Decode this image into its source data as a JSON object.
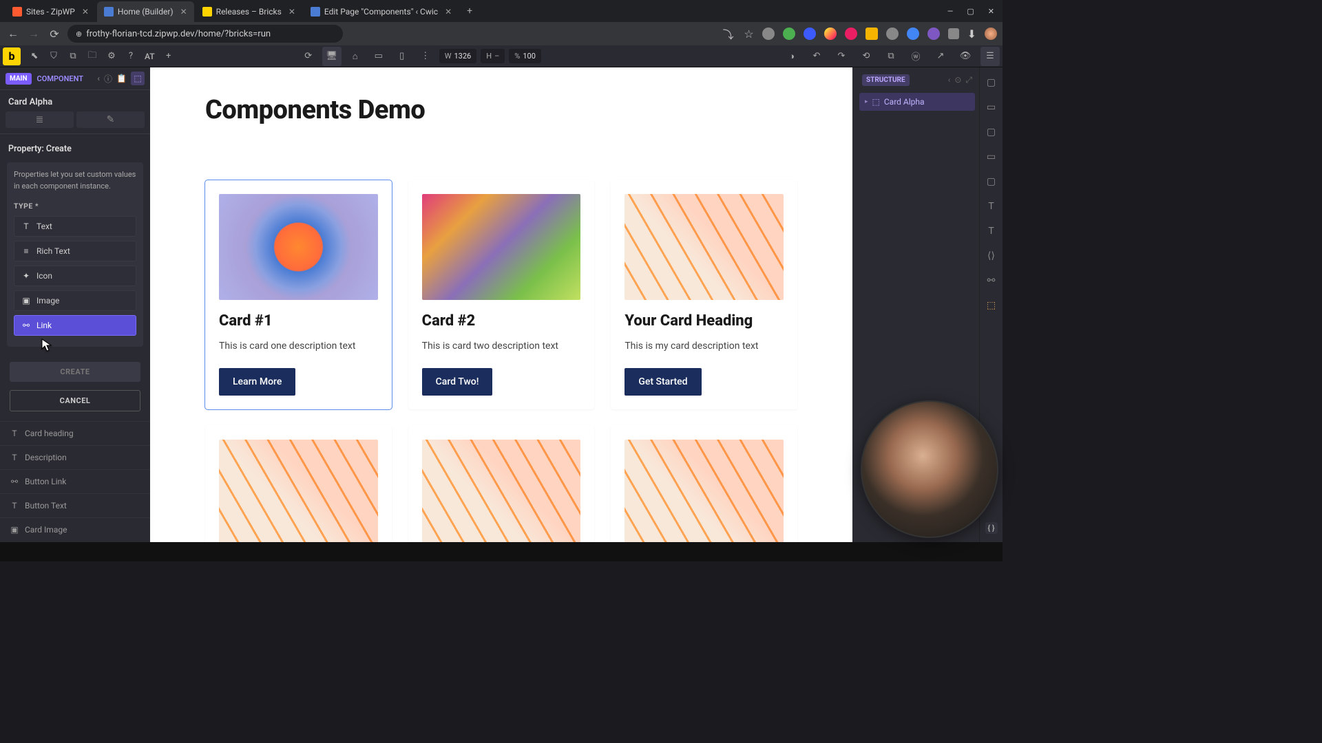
{
  "browser": {
    "tabs": [
      {
        "favColor": "#ff5a30",
        "label": "Sites - ZipWP"
      },
      {
        "favColor": "#4a7cd4",
        "label": "Home (Builder)",
        "active": true
      },
      {
        "favColor": "#ffd400",
        "label": "Releases – Bricks"
      },
      {
        "favColor": "#4a7cd4",
        "label": "Edit Page \"Components\" ‹ Cwic"
      }
    ],
    "url": "frothy-florian-tcd.zipwp.dev/home/?bricks=run"
  },
  "builder_header": {
    "at_label": "AT",
    "width_label": "W",
    "width_val": "1326",
    "height_label": "H",
    "height_val": "–",
    "pct_label": "%",
    "pct_val": "100"
  },
  "left_panel": {
    "badge_main": "MAIN",
    "badge_component": "COMPONENT",
    "component_name": "Card Alpha",
    "section_title": "Property: Create",
    "hint": "Properties let you set custom values in each component instance.",
    "type_label": "TYPE *",
    "type_options": [
      {
        "icon": "T",
        "label": "Text"
      },
      {
        "icon": "≡",
        "label": "Rich Text"
      },
      {
        "icon": "✦",
        "label": "Icon"
      },
      {
        "icon": "▣",
        "label": "Image"
      },
      {
        "icon": "⚯",
        "label": "Link",
        "selected": true
      }
    ],
    "btn_create": "CREATE",
    "btn_cancel": "CANCEL",
    "existing_properties": [
      {
        "icon": "T",
        "label": "Card heading"
      },
      {
        "icon": "T",
        "label": "Description"
      },
      {
        "icon": "⚯",
        "label": "Button Link"
      },
      {
        "icon": "T",
        "label": "Button Text"
      },
      {
        "icon": "▣",
        "label": "Card Image"
      }
    ]
  },
  "canvas": {
    "heading": "Components Demo",
    "cards": [
      {
        "selected": true,
        "imgClass": "img-a",
        "title": "Card #1",
        "desc": "This is card one description text",
        "btn": "Learn More"
      },
      {
        "imgClass": "img-b",
        "title": "Card #2",
        "desc": "This is card two description text",
        "btn": "Card Two!"
      },
      {
        "imgClass": "img-c",
        "title": "Your Card Heading",
        "desc": "This is my card description text",
        "btn": "Get Started"
      },
      {
        "imgClass": "img-c",
        "title": "",
        "desc": "",
        "btn": "",
        "partial": true
      },
      {
        "imgClass": "img-c",
        "title": "",
        "desc": "",
        "btn": "",
        "partial": true
      },
      {
        "imgClass": "img-c",
        "title": "",
        "desc": "",
        "btn": "",
        "partial": true
      }
    ]
  },
  "structure": {
    "badge": "STRUCTURE",
    "items": [
      {
        "label": "Card Alpha"
      }
    ]
  }
}
